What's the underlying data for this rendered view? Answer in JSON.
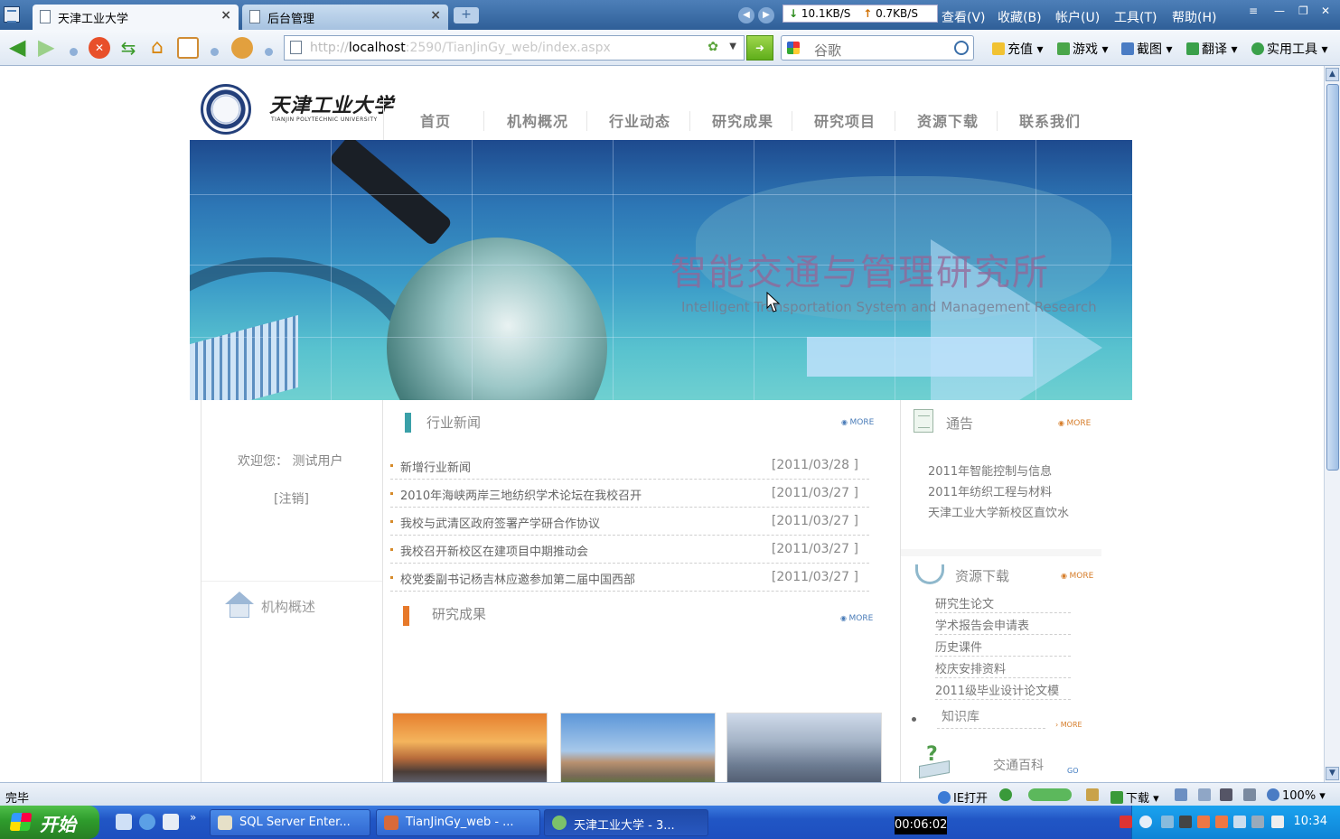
{
  "browser": {
    "tabs": [
      {
        "title": "天津工业大学",
        "active": true
      },
      {
        "title": "后台管理",
        "active": false
      }
    ],
    "speed": {
      "down": "10.1KB/S",
      "up": "0.7KB/S"
    },
    "menu": [
      "查看(V)",
      "收藏(B)",
      "帐户(U)",
      "工具(T)",
      "帮助(H)"
    ],
    "address": {
      "proto": "http://",
      "host": "localhost",
      "path": ":2590/TianJinGy_web/index.aspx"
    },
    "search_placeholder": "谷歌",
    "tools": [
      "充值",
      "游戏",
      "截图",
      "翻译",
      "实用工具"
    ]
  },
  "site": {
    "logo_text": "天津工业大学",
    "logo_sub": "TIANJIN POLYTECHNIC UNIVERSITY",
    "nav": [
      "首页",
      "机构概况",
      "行业动态",
      "研究成果",
      "研究项目",
      "资源下载",
      "联系我们"
    ],
    "banner": {
      "title_cn": "智能交通与管理研究所",
      "title_en": "Intelligent Transportation System and Management Research"
    },
    "welcome": "欢迎您： 测试用户",
    "logout": "[注销]",
    "org_overview": "机构概述",
    "news": {
      "title": "行业新闻",
      "more": "MORE",
      "items": [
        {
          "title": "新增行业新闻",
          "date": "[2011/03/28 ]"
        },
        {
          "title": "2010年海峡两岸三地纺织学术论坛在我校召开",
          "date": "[2011/03/27 ]"
        },
        {
          "title": "我校与武清区政府签署产学研合作协议",
          "date": "[2011/03/27 ]"
        },
        {
          "title": "我校召开新校区在建项目中期推动会",
          "date": "[2011/03/27 ]"
        },
        {
          "title": "校党委副书记杨吉林应邀参加第二届中国西部",
          "date": "[2011/03/27 ]"
        }
      ]
    },
    "research": {
      "title": "研究成果",
      "more": "MORE"
    },
    "notice": {
      "title": "通告",
      "more": "MORE",
      "items": [
        "2011年智能控制与信息",
        "2011年纺织工程与材料",
        "天津工业大学新校区直饮水"
      ]
    },
    "resources": {
      "title": "资源下载",
      "more": "MORE",
      "items": [
        "研究生论文",
        "学术报告会申请表",
        "历史课件",
        "校庆安排资料",
        "2011级毕业设计论文模"
      ]
    },
    "knowledge": {
      "title": "知识库",
      "more": "MORE"
    },
    "wiki": {
      "title": "交通百科",
      "go": "GO"
    }
  },
  "status": {
    "text": "完毕",
    "items": [
      "IE打开",
      "下载",
      "100%"
    ]
  },
  "taskbar": {
    "start": "开始",
    "tasks": [
      "SQL Server Enter...",
      "TianJinGy_web - ...",
      "天津工业大学 - 3..."
    ],
    "timer": "00:06:02",
    "clock": "10:34"
  }
}
